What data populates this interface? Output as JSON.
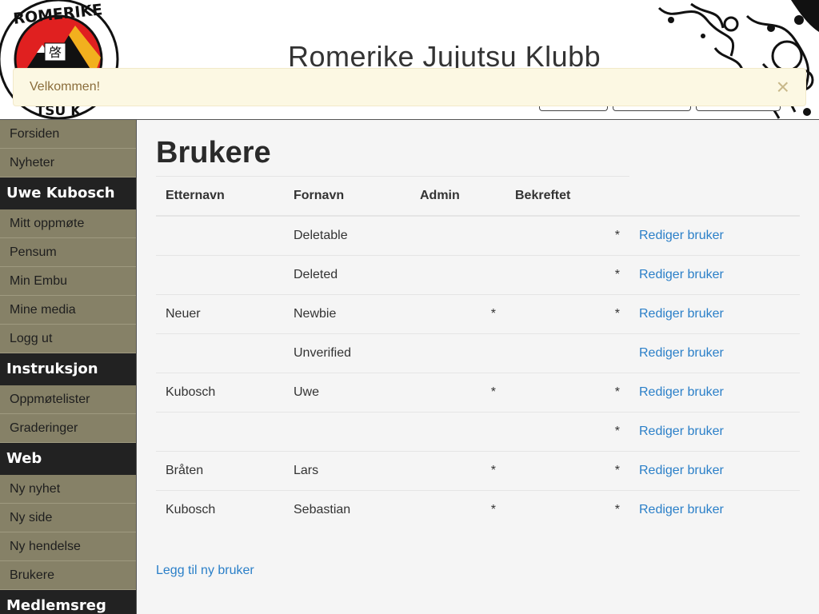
{
  "header": {
    "title": "Romerike Jujutsu Klubb",
    "logo": {
      "top_text": "ROMERIKE",
      "center_char": "啓",
      "bottom_text": "TSU K"
    }
  },
  "alert": {
    "text": "Velkommen!",
    "close": "×"
  },
  "sidebar": {
    "groups": [
      {
        "heading": "",
        "items": [
          "Forsiden",
          "Nyheter"
        ]
      },
      {
        "heading": "Uwe Kubosch",
        "items": [
          "Mitt oppmøte",
          "Pensum",
          "Min Embu",
          "Mine media",
          "Logg ut"
        ]
      },
      {
        "heading": "Instruksjon",
        "items": [
          "Oppmøtelister",
          "Graderinger"
        ]
      },
      {
        "heading": "Web",
        "items": [
          "Ny nyhet",
          "Ny side",
          "Ny hendelse",
          "Brukere"
        ]
      },
      {
        "heading": "Medlemsreg",
        "items": []
      }
    ]
  },
  "main": {
    "title": "Brukere",
    "columns": [
      "Etternavn",
      "Fornavn",
      "Admin",
      "Bekreftet"
    ],
    "rows": [
      {
        "last": "",
        "first": "Deletable",
        "admin": "",
        "verified": "*",
        "action": "Rediger bruker"
      },
      {
        "last": "",
        "first": "Deleted",
        "admin": "",
        "verified": "*",
        "action": "Rediger bruker"
      },
      {
        "last": "Neuer",
        "first": "Newbie",
        "admin": "*",
        "verified": "*",
        "action": "Rediger bruker"
      },
      {
        "last": "",
        "first": "Unverified",
        "admin": "",
        "verified": "",
        "action": "Rediger bruker"
      },
      {
        "last": "Kubosch",
        "first": "Uwe",
        "admin": "*",
        "verified": "*",
        "action": "Rediger bruker"
      },
      {
        "last": "",
        "first": "",
        "admin": "",
        "verified": "*",
        "action": "Rediger bruker"
      },
      {
        "last": "Bråten",
        "first": "Lars",
        "admin": "*",
        "verified": "*",
        "action": "Rediger bruker"
      },
      {
        "last": "Kubosch",
        "first": "Sebastian",
        "admin": "*",
        "verified": "*",
        "action": "Rediger bruker"
      }
    ],
    "add_link": "Legg til ny bruker"
  },
  "colors": {
    "sidebar_bg": "#858065",
    "sidebar_heading_bg": "#222222",
    "link": "#2a7fc8",
    "alert_bg": "#fcf8e3",
    "alert_text": "#8a6d3b"
  }
}
